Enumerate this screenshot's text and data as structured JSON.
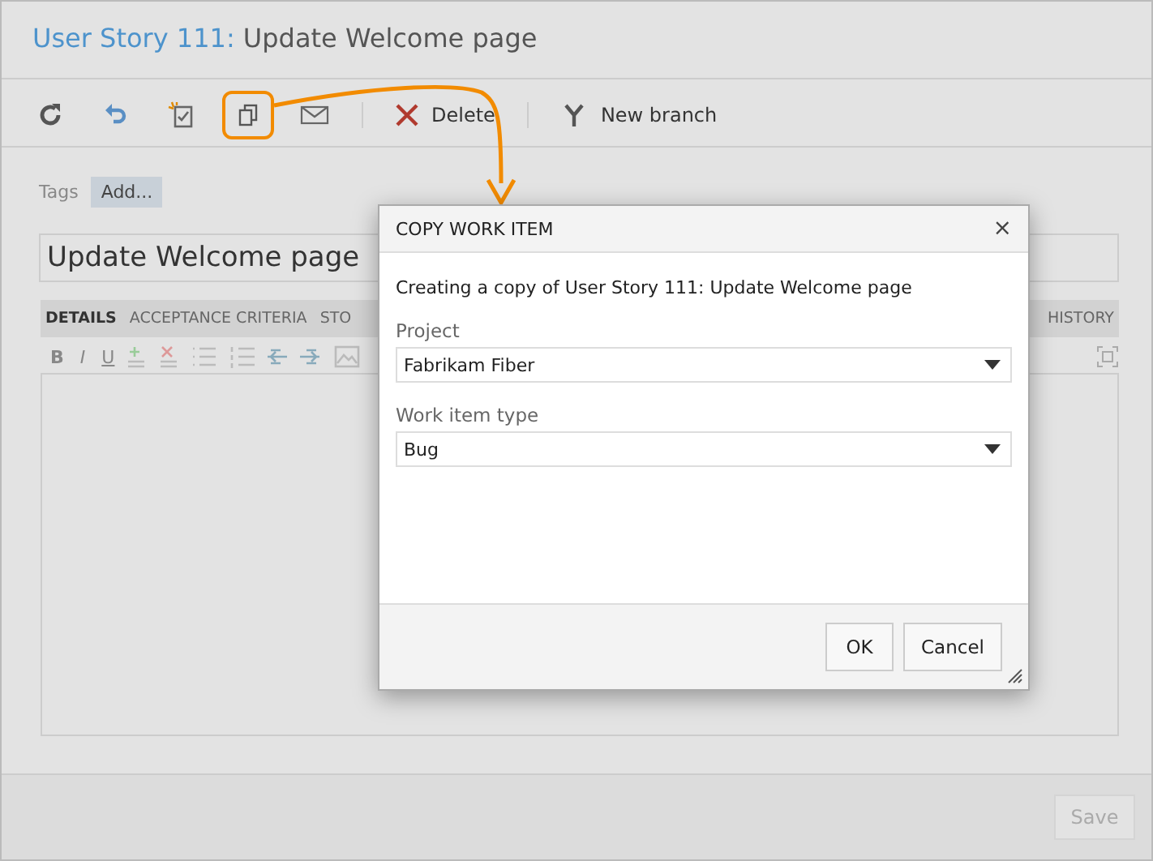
{
  "header": {
    "item_ref": "User Story 111:",
    "title": "Update Welcome page"
  },
  "toolbar": [
    {
      "kind": "refresh",
      "highlighted": false
    },
    {
      "kind": "undo",
      "highlighted": false
    },
    {
      "kind": "follow",
      "highlighted": false
    },
    {
      "kind": "copy",
      "highlighted": true
    },
    {
      "kind": "email",
      "highlighted": false
    },
    {
      "kind": "delete",
      "label": "Delete",
      "highlighted": false
    },
    {
      "kind": "branch",
      "label": "New branch",
      "highlighted": false
    }
  ],
  "tags": {
    "label": "Tags",
    "button": "Add..."
  },
  "title_field": {
    "value": "Update Welcome page"
  },
  "tabs": [
    {
      "label": "DETAILS",
      "selected": true
    },
    {
      "label": "ACCEPTANCE CRITERIA",
      "selected": false
    },
    {
      "label": "STO",
      "selected": false
    },
    {
      "label": "HISTORY",
      "selected": false
    }
  ],
  "format_buttons": [
    "B",
    "I",
    "U"
  ],
  "dialog": {
    "title": "COPY WORK ITEM",
    "close": "×",
    "message": "Creating a copy of User Story 111: Update Welcome page",
    "fields": [
      {
        "label": "Project",
        "value": "Fabrikam Fiber"
      },
      {
        "label": "Work item type",
        "value": "Bug"
      }
    ],
    "buttons": [
      "OK",
      "Cancel"
    ]
  },
  "save": {
    "label": "Save",
    "disabled": true
  }
}
